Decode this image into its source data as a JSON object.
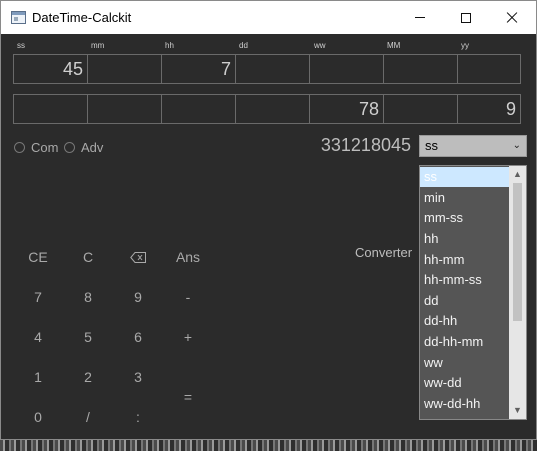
{
  "window": {
    "title": "DateTime-Calckit"
  },
  "labels": [
    "ss",
    "mm",
    "hh",
    "dd",
    "ww",
    "MM",
    "yy"
  ],
  "row1": [
    "45",
    "",
    "7",
    "",
    "",
    "",
    ""
  ],
  "row2": [
    "",
    "",
    "",
    "",
    "78",
    "",
    "9"
  ],
  "modes": [
    "Com",
    "Adv"
  ],
  "result": "331218045",
  "unit_select": {
    "value": "ss"
  },
  "unit_options": [
    "ss",
    "min",
    "mm-ss",
    "hh",
    "hh-mm",
    "hh-mm-ss",
    "dd",
    "dd-hh",
    "dd-hh-mm",
    "ww",
    "ww-dd",
    "ww-dd-hh"
  ],
  "converter_label": "Converter",
  "keys": {
    "ce": "CE",
    "c": "C",
    "ans": "Ans",
    "k7": "7",
    "k8": "8",
    "k9": "9",
    "minus": "-",
    "k4": "4",
    "k5": "5",
    "k6": "6",
    "plus": "+",
    "k1": "1",
    "k2": "2",
    "k3": "3",
    "equals": "=",
    "k0": "0",
    "slash": "/",
    "colon": ":"
  },
  "colors": {
    "background": "#2b2b2b",
    "text": "#a9a9a9",
    "highlight": "#cde8ff"
  }
}
